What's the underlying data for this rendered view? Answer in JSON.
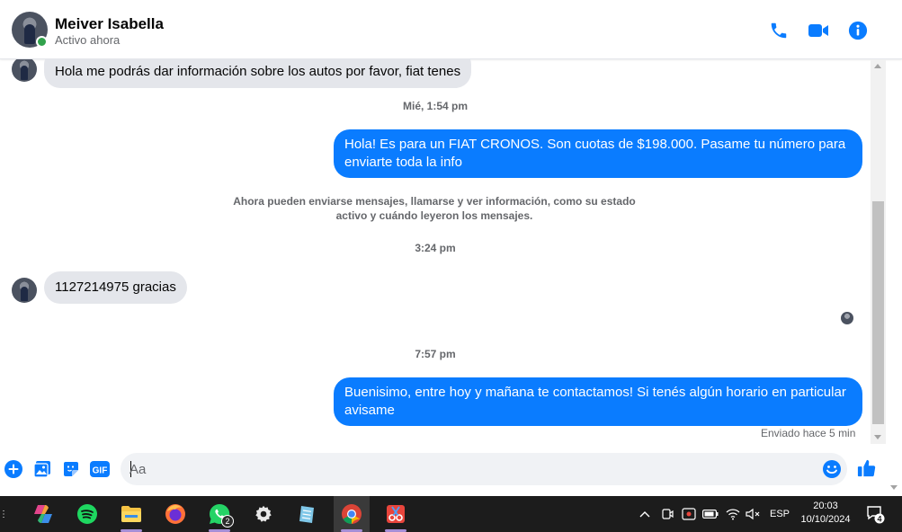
{
  "header": {
    "name": "Meiver Isabella",
    "status": "Activo ahora",
    "icons": [
      "phone-icon",
      "video-call-icon",
      "info-icon"
    ]
  },
  "messages": [
    {
      "direction": "in",
      "text": "Hola me podrás dar información sobre los autos por favor, fiat tenes"
    },
    {
      "type": "timestamp",
      "text": "Mié, 1:54 pm"
    },
    {
      "direction": "out",
      "lines": [
        "Hola! Es para un FIAT CRONOS. Son cuotas de $198.000. Pasame tu número para",
        "enviarte toda la info"
      ]
    },
    {
      "type": "system",
      "lines": [
        "Ahora pueden enviarse mensajes, llamarse y ver información, como su estado",
        "activo y cuándo leyeron los mensajes."
      ]
    },
    {
      "type": "timestamp",
      "text": "3:24 pm"
    },
    {
      "direction": "in",
      "text": "1127214975 gracias"
    },
    {
      "type": "timestamp",
      "text": "7:57 pm"
    },
    {
      "direction": "out",
      "lines": [
        "Buenisimo, entre hoy y mañana te contactamos! Si tenés algún horario en particular",
        "avisame"
      ]
    }
  ],
  "sent_status": "Enviado hace 5 min",
  "composer": {
    "placeholder": "Aa",
    "icons": [
      "plus-circle-icon",
      "photo-icon",
      "sticker-icon",
      "gif-icon",
      "emoji-icon",
      "thumbs-up-icon"
    ],
    "gif_label": "GIF"
  },
  "taskbar": {
    "apps": [
      "copilot-icon",
      "spotify-icon",
      "file-explorer-icon",
      "firefox-icon",
      "whatsapp-icon",
      "settings-icon",
      "notepad-icon",
      "chrome-icon",
      "snipping-tool-icon"
    ],
    "whatsapp_badge": "2",
    "language": "ESP",
    "time": "20:03",
    "date": "10/10/2024",
    "notification_count": "4"
  },
  "colors": {
    "accent": "#0a7cff",
    "incoming_bubble": "#e4e6eb",
    "online": "#31a24c",
    "taskbar": "#1c1c1c"
  }
}
